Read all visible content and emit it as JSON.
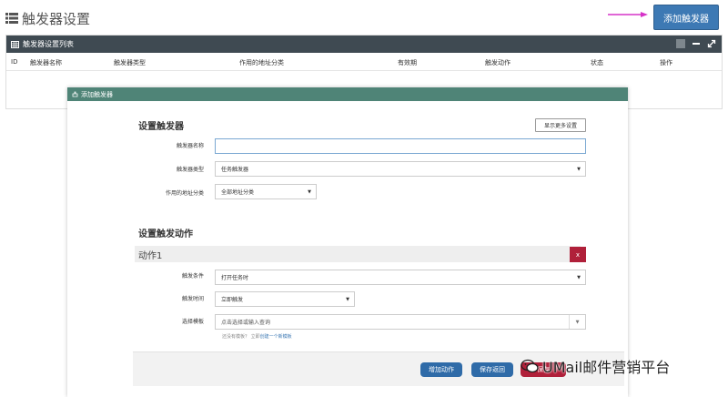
{
  "header": {
    "title": "触发器设置",
    "add_button_label": "添加触发器"
  },
  "list_panel": {
    "title": "触发器设置列表",
    "columns": [
      "ID",
      "触发器名称",
      "触发器类型",
      "作用的地址分类",
      "有效期",
      "触发动作",
      "状态",
      "操作"
    ]
  },
  "modal": {
    "title": "添加触发器",
    "section_trigger": "设置触发器",
    "more_settings_label": "显示更多设置",
    "fields": {
      "name_label": "触发器名称",
      "name_value": "",
      "type_label": "触发器类型",
      "type_value": "任务触发器",
      "address_label": "作用的地址分类",
      "address_value": "全部地址分类"
    },
    "section_action": "设置触发动作",
    "action": {
      "label": "动作1",
      "close_label": "x",
      "condition_label": "触发条件",
      "condition_value": "打开任务时",
      "time_label": "触发时间",
      "time_value": "立即触发",
      "template_label": "选择模板",
      "template_placeholder": "点击选择或输入查询"
    },
    "hint_text": "还没有模板？ 立即",
    "hint_link": "创建一个新模板",
    "footer": {
      "add_action_label": "增加动作",
      "save_return_label": "保存返回",
      "save_label": "保存"
    }
  },
  "watermark": {
    "text": "UMail邮件营销平台"
  },
  "colors": {
    "primary": "#3d79b4",
    "modal_header": "#4f8477",
    "danger": "#b0203a",
    "arrow": "#d633c8"
  }
}
